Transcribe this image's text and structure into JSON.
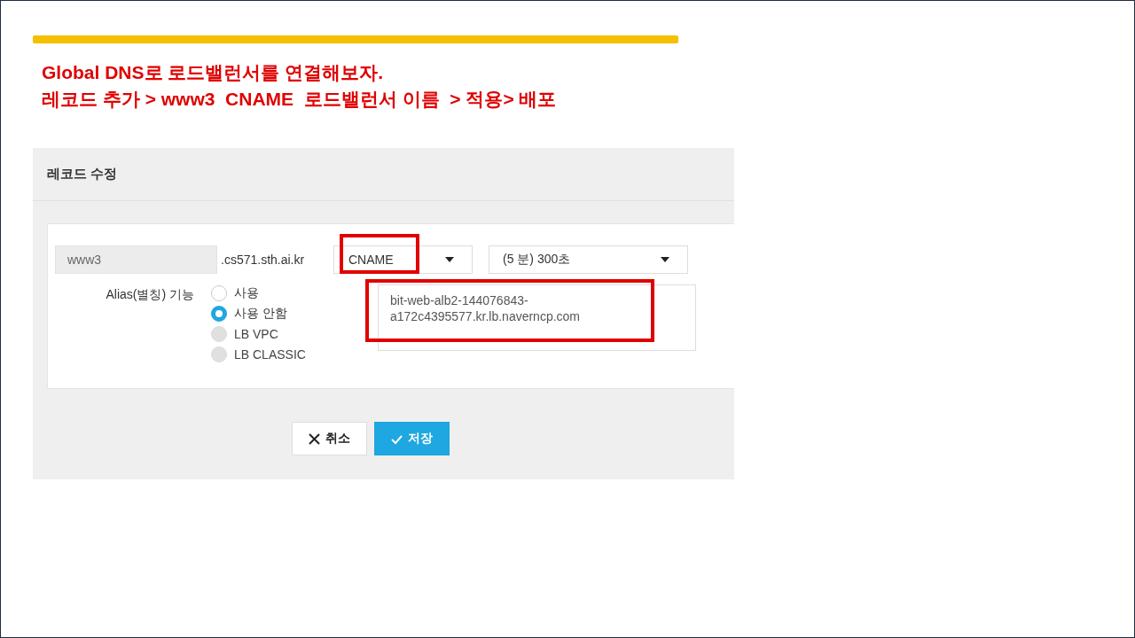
{
  "slide": {
    "title_lines": [
      "Global DNS로 로드밸런서를 연결해보자.",
      "레코드 추가 > www3  CNAME  로드밸런서 이름  > 적용> 배포"
    ]
  },
  "dialog": {
    "title": "레코드 수정",
    "record_name": "www3",
    "domain_suffix": ".cs571.sth.ai.kr",
    "record_type": {
      "value": "CNAME",
      "highlighted": true
    },
    "ttl": {
      "value": "(5 분) 300초"
    },
    "alias_label": "Alias(별칭) 기능",
    "alias_options": [
      {
        "label": "사용",
        "selected": false,
        "disabled": false
      },
      {
        "label": "사용 안함",
        "selected": true,
        "disabled": false
      },
      {
        "label": "LB VPC",
        "selected": false,
        "disabled": true
      },
      {
        "label": "LB CLASSIC",
        "selected": false,
        "disabled": true
      }
    ],
    "record_value": {
      "value": "bit-web-alb2-144076843-\na172c4395577.kr.lb.naverncp.com",
      "highlighted": true
    },
    "buttons": [
      {
        "kind": "cancel",
        "label": "취소"
      },
      {
        "kind": "save",
        "label": "저장"
      }
    ]
  }
}
